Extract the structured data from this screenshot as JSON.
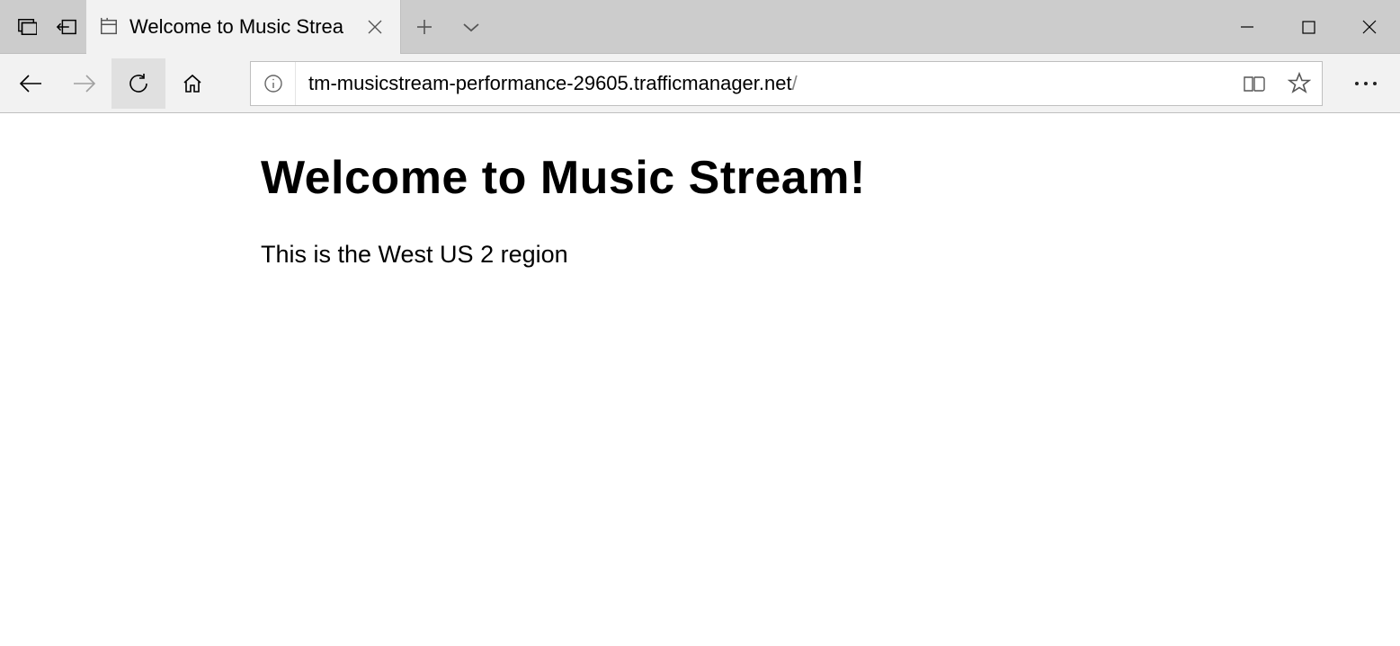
{
  "tab": {
    "title": "Welcome to Music Strea"
  },
  "address": {
    "host": "tm-musicstream-performance-29605.trafficmanager.net",
    "path": "/"
  },
  "page": {
    "heading": "Welcome to Music Stream!",
    "body": "This is the West US 2 region"
  }
}
